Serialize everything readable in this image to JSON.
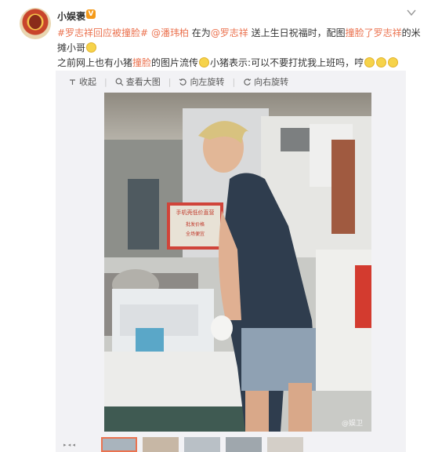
{
  "post": {
    "username": "小娱褒",
    "vip_badge": "V",
    "line1_hashtag": "#罗志祥回应被撞脸#",
    "line1_mention1": "@潘玮柏",
    "line1_mid": " 在为",
    "line1_mention2": "@罗志祥",
    "line1_mid2": " 送上生日祝福时，配图",
    "line1_hl": "撞脸了罗志祥",
    "line1_end": "的米",
    "line2": "摊小哥",
    "line3_start": "之前网上也有小猪",
    "line3_hl": "撞脸",
    "line3_mid": "的图片流传",
    "line3_end": "小猪表示:可以不要打扰我上班吗，哼"
  },
  "toolbar": {
    "collapse": "收起",
    "view_large": "查看大图",
    "rotate_left": "向左旋转",
    "rotate_right": "向右旋转"
  },
  "photo": {
    "sign_title": "手机壳低价直营",
    "sign_line2": "批发价格",
    "sign_line3": "全场便宜",
    "watermark": "@娱卫"
  },
  "thumbnails": {
    "label": "▸ ◂ ◂"
  },
  "colors": {
    "link": "#eb7350",
    "badge": "#f49a1a",
    "media_bg": "#f2f2f5"
  }
}
